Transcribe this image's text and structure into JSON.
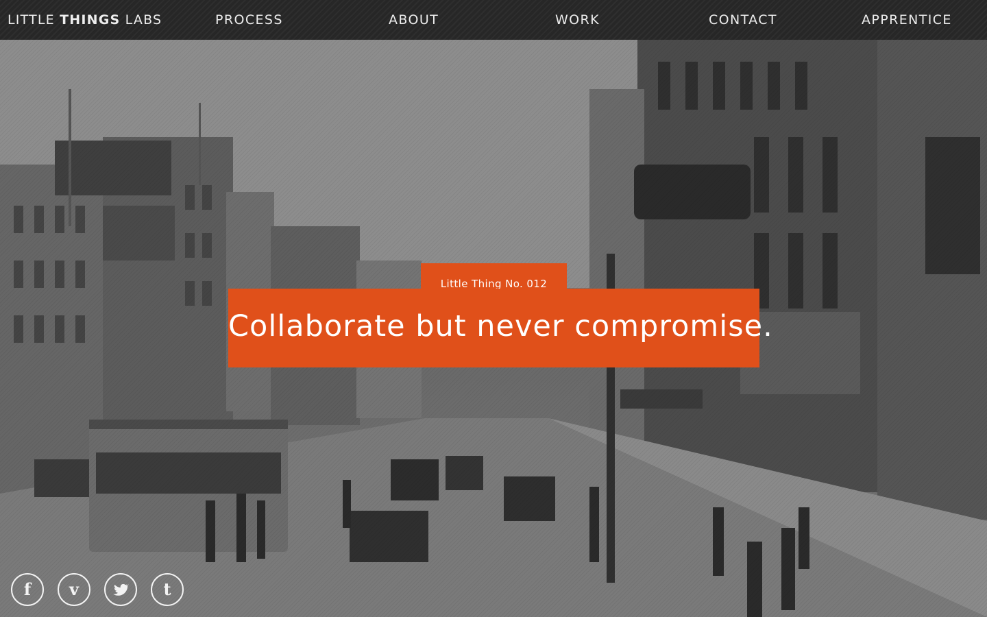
{
  "brand": {
    "part1": "LITTLE ",
    "part2": "THINGS",
    "part3": " LABS"
  },
  "nav": {
    "process": "PROCESS",
    "about": "ABOUT",
    "work": "WORK",
    "contact": "CONTACT",
    "apprentice": "APPRENTICE"
  },
  "hero": {
    "tag": "Little Thing No. 012",
    "headline": "Collaborate but never compromise."
  },
  "social": {
    "facebook": "f",
    "vimeo": "v",
    "twitter": "twitter-icon",
    "tumblr": "t"
  },
  "colors": {
    "accent": "#e0501a",
    "nav_bg": "#262626",
    "text_light": "#f2f2f2"
  }
}
